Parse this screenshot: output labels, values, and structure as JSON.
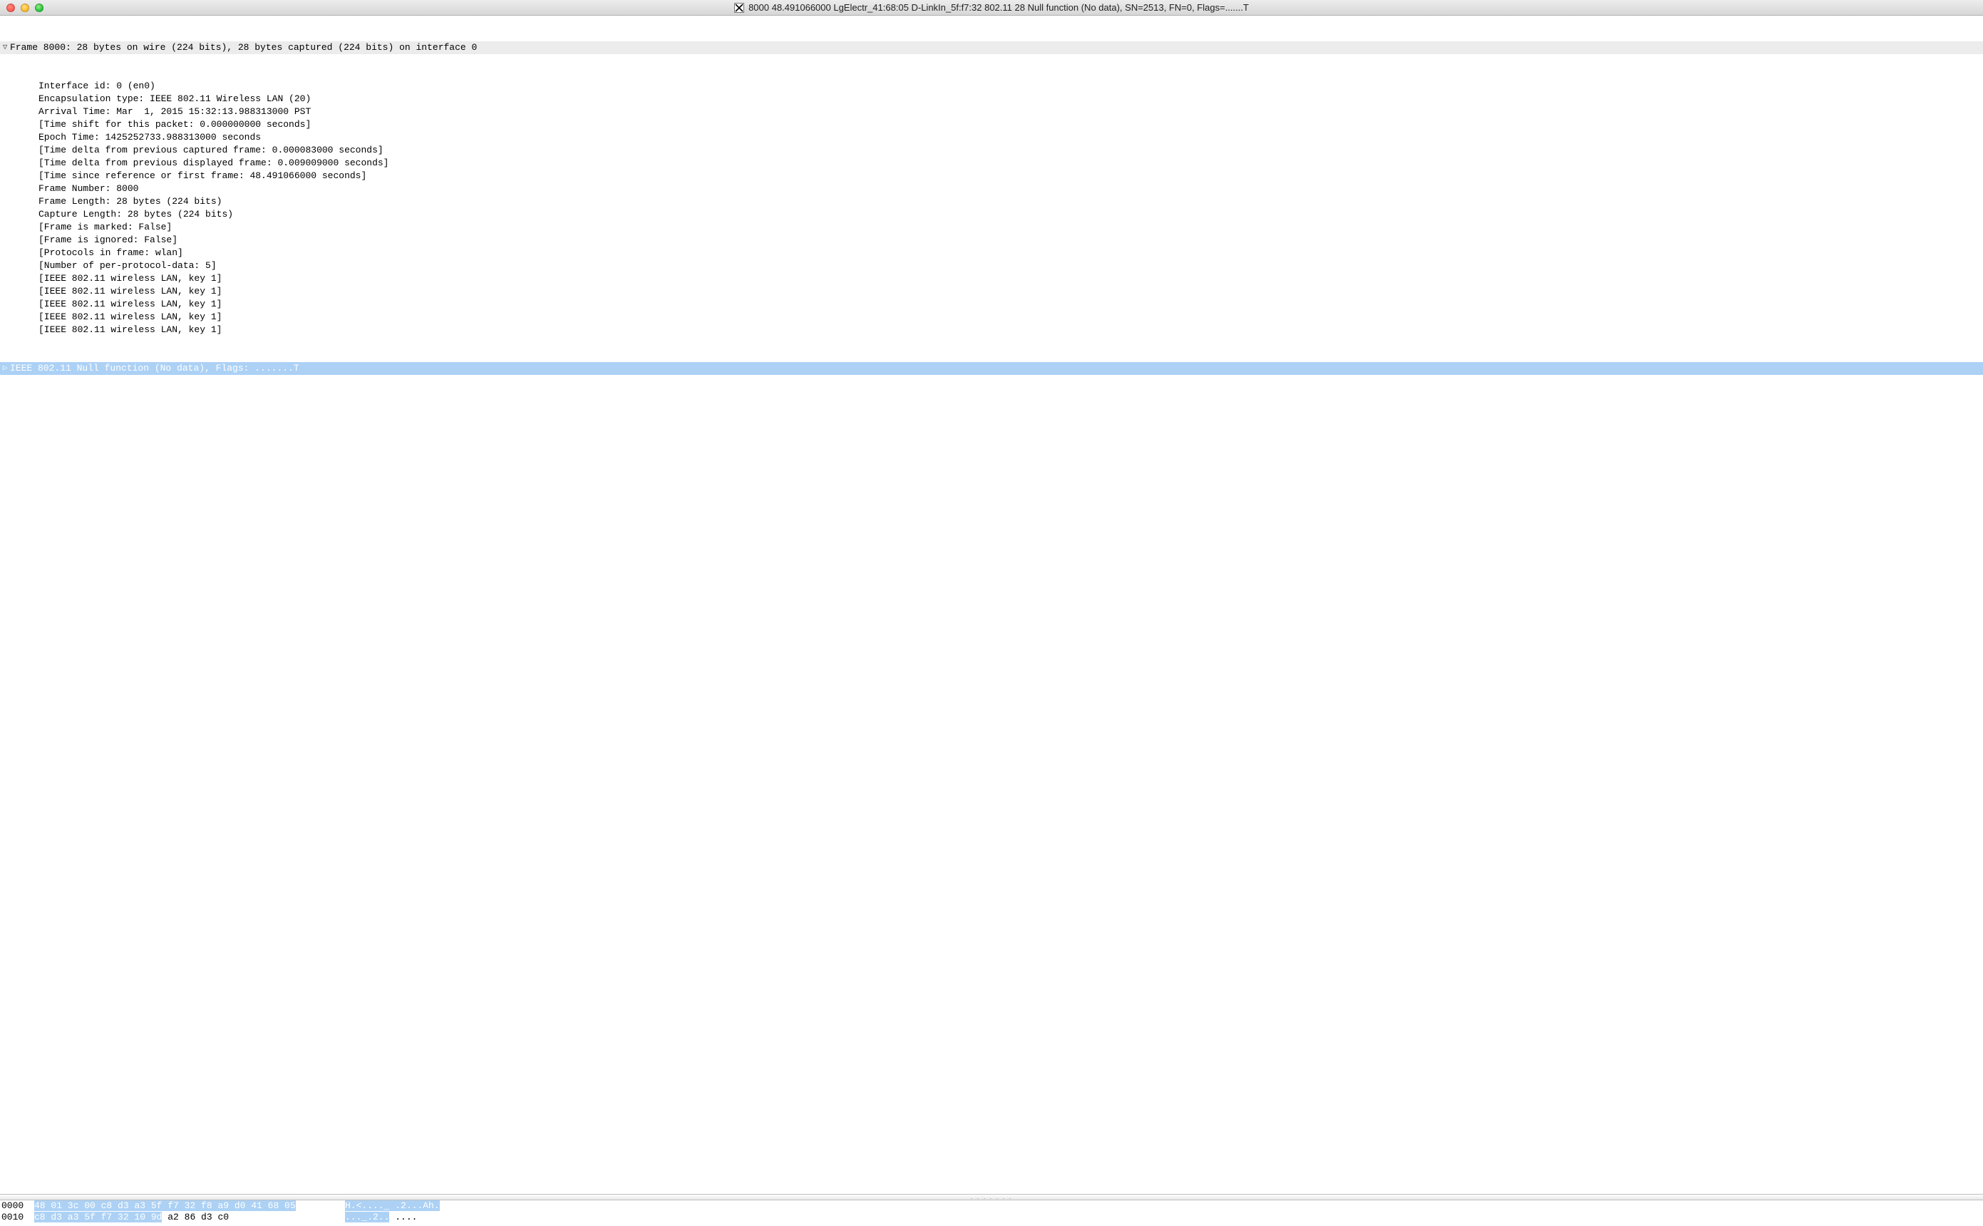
{
  "window": {
    "title": "8000 48.491066000 LgElectr_41:68:05 D-LinkIn_5f:f7:32 802.11 28 Null function (No data), SN=2513, FN=0, Flags=.......T"
  },
  "details": {
    "frame_header": "Frame 8000: 28 bytes on wire (224 bits), 28 bytes captured (224 bits) on interface 0",
    "children": [
      "Interface id: 0 (en0)",
      "Encapsulation type: IEEE 802.11 Wireless LAN (20)",
      "Arrival Time: Mar  1, 2015 15:32:13.988313000 PST",
      "[Time shift for this packet: 0.000000000 seconds]",
      "Epoch Time: 1425252733.988313000 seconds",
      "[Time delta from previous captured frame: 0.000083000 seconds]",
      "[Time delta from previous displayed frame: 0.009009000 seconds]",
      "[Time since reference or first frame: 48.491066000 seconds]",
      "Frame Number: 8000",
      "Frame Length: 28 bytes (224 bits)",
      "Capture Length: 28 bytes (224 bits)",
      "[Frame is marked: False]",
      "[Frame is ignored: False]",
      "[Protocols in frame: wlan]",
      "[Number of per-protocol-data: 5]",
      "[IEEE 802.11 wireless LAN, key 1]",
      "[IEEE 802.11 wireless LAN, key 1]",
      "[IEEE 802.11 wireless LAN, key 1]",
      "[IEEE 802.11 wireless LAN, key 1]",
      "[IEEE 802.11 wireless LAN, key 1]"
    ],
    "wlan_header": "IEEE 802.11 Null function (No data), Flags: .......T"
  },
  "splitter_dots": ". . . . . . .",
  "hex": {
    "rows": [
      {
        "offset": "0000",
        "bytes_hl": "48 01 3c 00 c8 d3 a3 5f  f7 32 f8 a9 d0 41 68 05",
        "bytes_plain": "",
        "ascii_hl": "H.<...._ .2...Ah.",
        "ascii_plain": ""
      },
      {
        "offset": "0010",
        "bytes_hl": "c8 d3 a3 5f f7 32 10 9d",
        "bytes_plain": "  a2 86 d3 c0",
        "ascii_hl": "..._.2..",
        "ascii_plain": " ...."
      }
    ]
  }
}
